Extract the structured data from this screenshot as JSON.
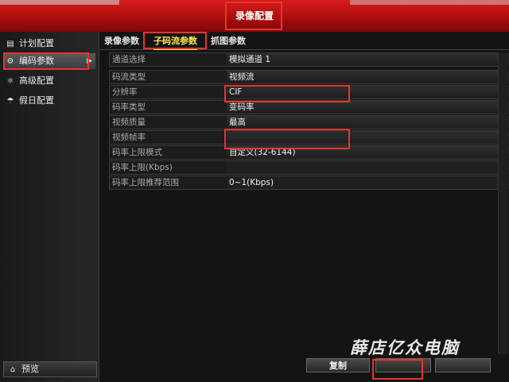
{
  "window": {
    "title": "录像配置"
  },
  "sidebar": {
    "items": [
      {
        "label": "计划配置",
        "icon": "schedule-icon",
        "glyph": "▤"
      },
      {
        "label": "编码参数",
        "icon": "gear-icon",
        "glyph": "⚙"
      },
      {
        "label": "高级配置",
        "icon": "advanced-icon",
        "glyph": "⚛"
      },
      {
        "label": "假日配置",
        "icon": "holiday-icon",
        "glyph": "☂"
      }
    ],
    "preview": {
      "label": "预览",
      "icon": "home-icon",
      "glyph": "⌂"
    }
  },
  "tabs": [
    {
      "label": "录像参数"
    },
    {
      "label": "子码流参数"
    },
    {
      "label": "抓图参数"
    }
  ],
  "settings": [
    {
      "label": "通道选择",
      "value": "模拟通道 1"
    },
    {
      "label": "码流类型",
      "value": "视频流"
    },
    {
      "label": "分辨率",
      "value": "CIF"
    },
    {
      "label": "码率类型",
      "value": "变码率"
    },
    {
      "label": "视频质量",
      "value": "最高"
    },
    {
      "label": "视频帧率",
      "value": ""
    },
    {
      "label": "码率上限模式",
      "value": "自定义(32-6144)"
    },
    {
      "label": "码率上限(Kbps)",
      "value": ""
    },
    {
      "label": "码率上限推荐范围",
      "value": "0~1(Kbps)"
    }
  ],
  "footer": {
    "copy_label": "复制"
  },
  "watermark": "薛店亿众电脑",
  "colors": {
    "accent": "#d81c1c",
    "highlight": "#e8342f",
    "active_tab": "#ffe84d"
  }
}
